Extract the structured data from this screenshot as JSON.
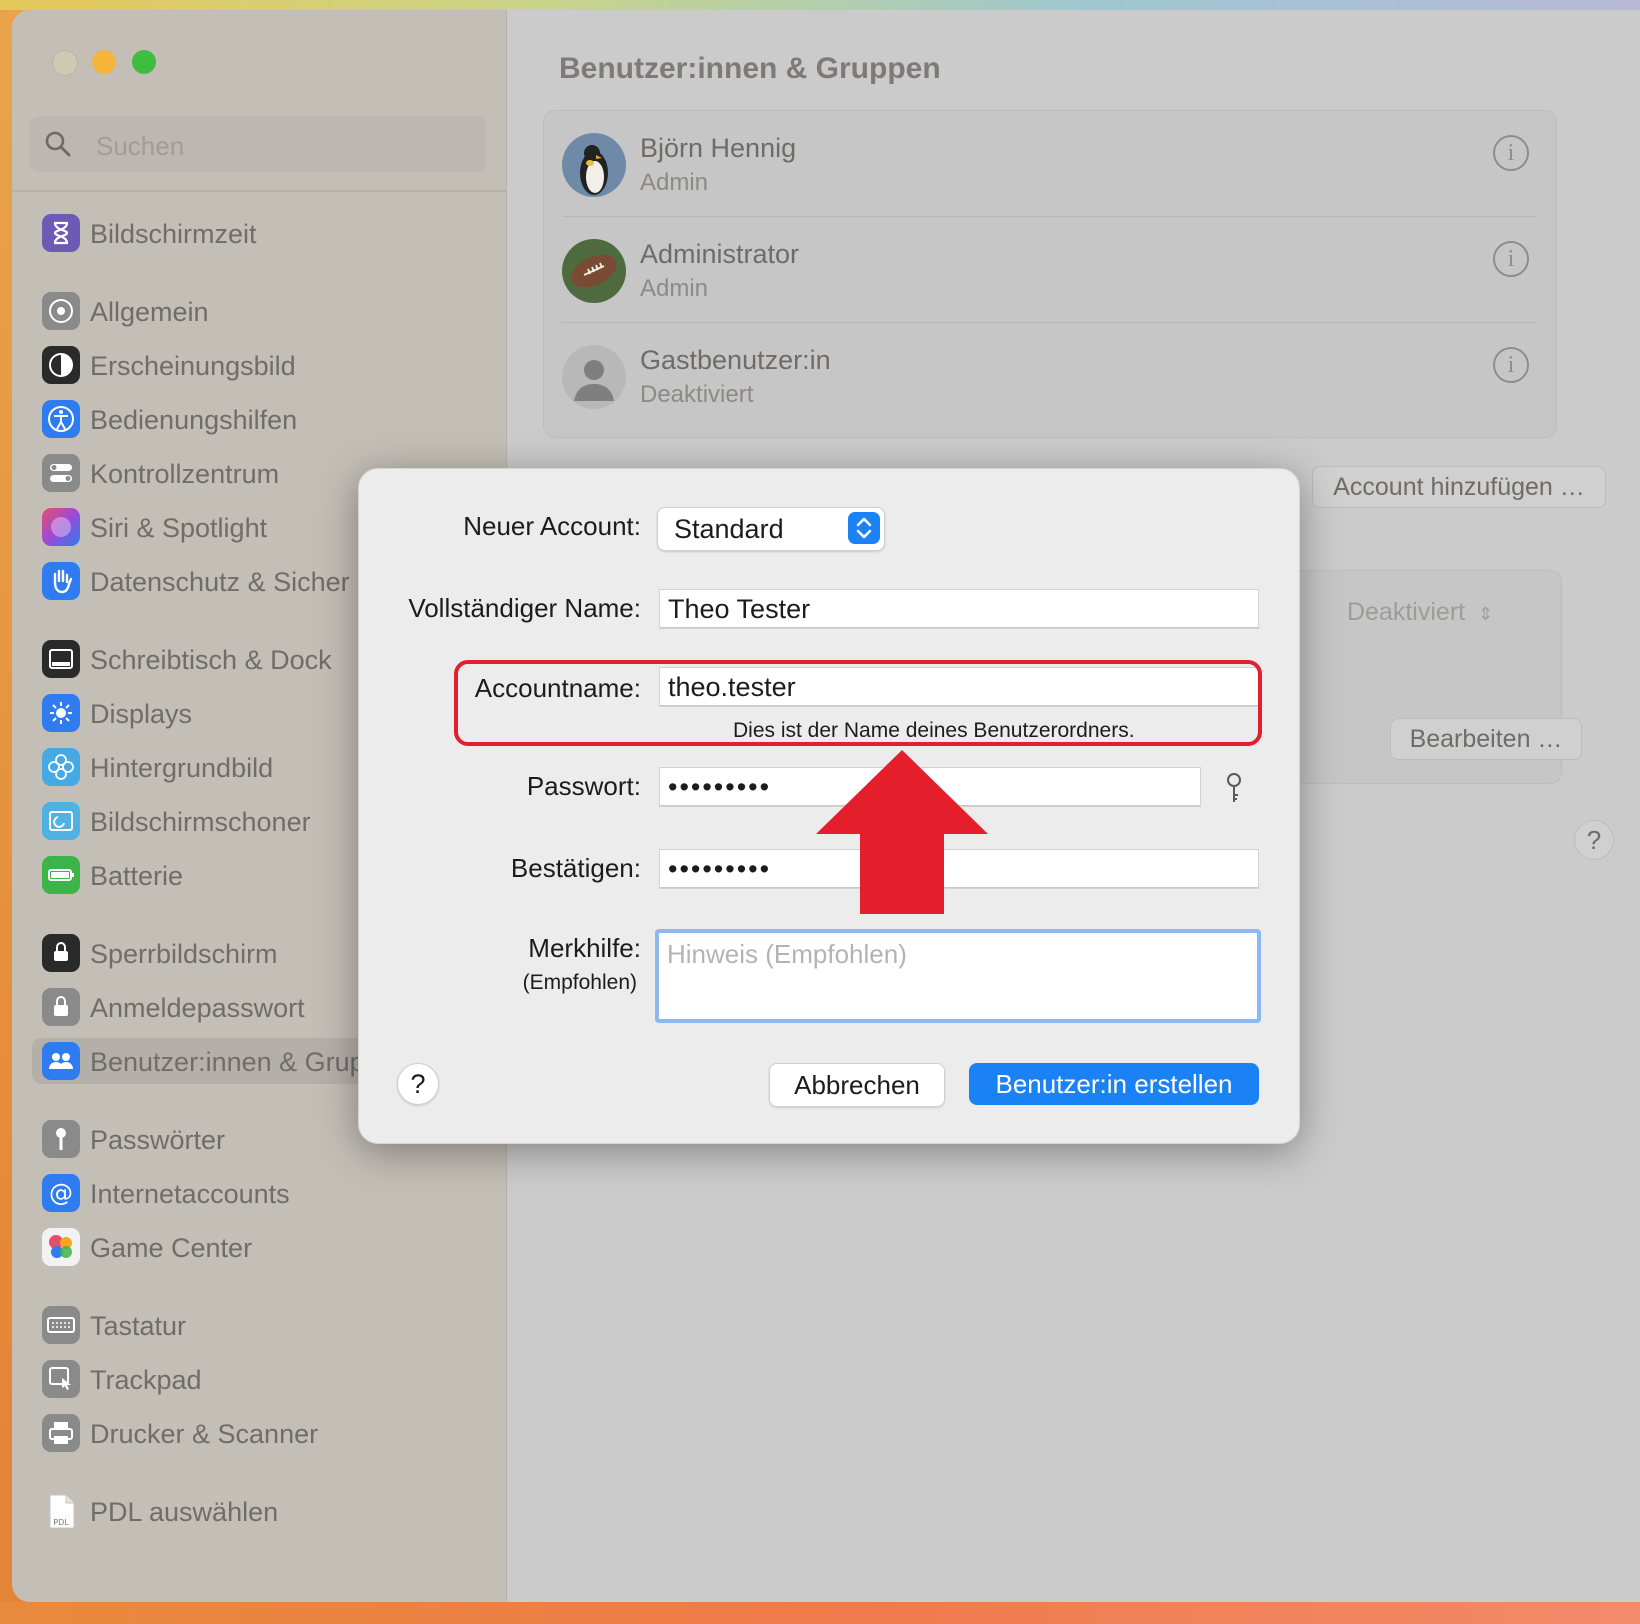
{
  "sidebar": {
    "search_placeholder": "Suchen",
    "items": [
      {
        "label": "Bildschirmzeit",
        "icon": "hourglass-icon",
        "color": "#6b5bb5"
      },
      {
        "label": "Allgemein",
        "icon": "gear-icon",
        "color": "#8a8a8a"
      },
      {
        "label": "Erscheinungsbild",
        "icon": "appearance-icon",
        "color": "#2a2a2a"
      },
      {
        "label": "Bedienungshilfen",
        "icon": "accessibility-icon",
        "color": "#2f7cf0"
      },
      {
        "label": "Kontrollzentrum",
        "icon": "toggles-icon",
        "color": "#8a8a8a"
      },
      {
        "label": "Siri & Spotlight",
        "icon": "siri-icon",
        "color": "#9b4ad8"
      },
      {
        "label": "Datenschutz & Sicher",
        "icon": "hand-icon",
        "color": "#2f7cf0"
      },
      {
        "label": "Schreibtisch & Dock",
        "icon": "dock-icon",
        "color": "#2a2a2a"
      },
      {
        "label": "Displays",
        "icon": "sun-icon",
        "color": "#2f7cf0"
      },
      {
        "label": "Hintergrundbild",
        "icon": "flower-icon",
        "color": "#45a9e4"
      },
      {
        "label": "Bildschirmschoner",
        "icon": "screensaver-icon",
        "color": "#4fb2e2"
      },
      {
        "label": "Batterie",
        "icon": "battery-icon",
        "color": "#3bb54a"
      },
      {
        "label": "Sperrbildschirm",
        "icon": "lock-screen-icon",
        "color": "#2a2a2a"
      },
      {
        "label": "Anmeldepasswort",
        "icon": "lock-icon",
        "color": "#8a8a8a"
      },
      {
        "label": "Benutzer:innen & Grup",
        "icon": "users-icon",
        "color": "#2f7cf0"
      },
      {
        "label": "Passwörter",
        "icon": "key-icon",
        "color": "#8a8a8a"
      },
      {
        "label": "Internetaccounts",
        "icon": "at-icon",
        "color": "#2f7cf0"
      },
      {
        "label": "Game Center",
        "icon": "game-center-icon",
        "color": "#e84d6b"
      },
      {
        "label": "Tastatur",
        "icon": "keyboard-icon",
        "color": "#8a8a8a"
      },
      {
        "label": "Trackpad",
        "icon": "trackpad-icon",
        "color": "#8a8a8a"
      },
      {
        "label": "Drucker & Scanner",
        "icon": "printer-icon",
        "color": "#8a8a8a"
      },
      {
        "label": "PDL auswählen",
        "icon": "pdl-file-icon",
        "icon_text": "PDL",
        "color": "#ffffff"
      }
    ]
  },
  "main": {
    "title": "Benutzer:innen & Gruppen",
    "users": [
      {
        "name": "Björn Hennig",
        "role": "Admin",
        "avatar": "penguin-avatar"
      },
      {
        "name": "Administrator",
        "role": "Admin",
        "avatar": "football-avatar"
      },
      {
        "name": "Gastbenutzer:in",
        "role": "Deaktiviert",
        "avatar": "guest-avatar"
      }
    ],
    "add_account_label": "Account hinzufügen …",
    "auto_login_value": "Deaktiviert",
    "edit_label": "Bearbeiten …",
    "help_label": "?"
  },
  "dialog": {
    "new_account_label": "Neuer Account:",
    "new_account_value": "Standard",
    "full_name_label": "Vollständiger Name:",
    "full_name_value": "Theo Tester",
    "account_name_label": "Accountname:",
    "account_name_value": "theo.tester",
    "account_name_hint": "Dies ist der Name deines Benutzerordners.",
    "password_label": "Passwort:",
    "password_value": "•••••••••",
    "confirm_label": "Bestätigen:",
    "confirm_value": "•••••••••",
    "hint_label": "Merkhilfe:",
    "hint_sublabel": "(Empfohlen)",
    "hint_placeholder": "Hinweis (Empfohlen)",
    "help_label": "?",
    "cancel_label": "Abbrechen",
    "create_label": "Benutzer:in erstellen"
  },
  "colors": {
    "accent": "#1a82f5",
    "annotation": "#e0202e"
  }
}
